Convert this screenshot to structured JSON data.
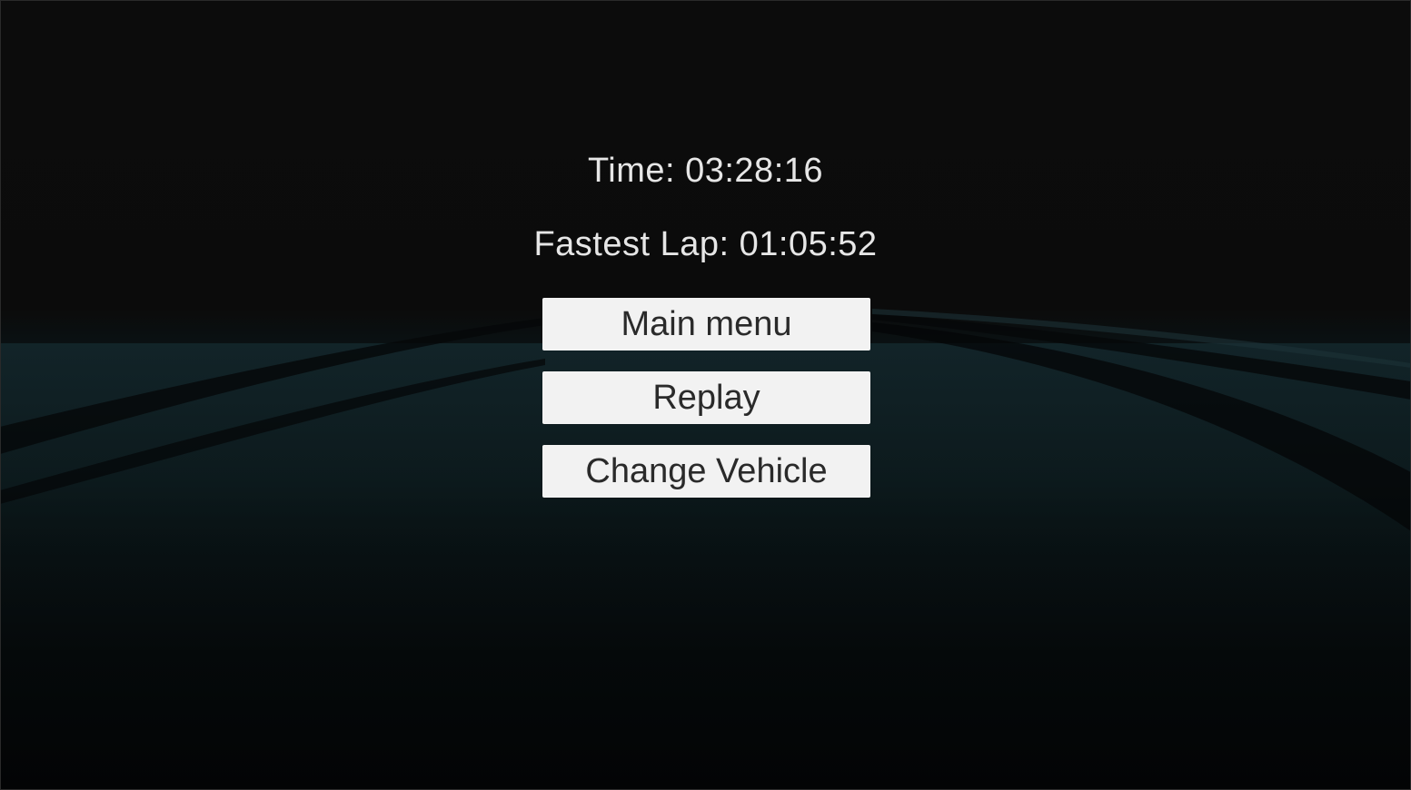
{
  "results": {
    "time_text": "Time: 03:28:16",
    "fastest_lap_text": "Fastest Lap: 01:05:52"
  },
  "menu": {
    "main_menu_label": "Main menu",
    "replay_label": "Replay",
    "change_vehicle_label": "Change Vehicle"
  },
  "colors": {
    "background": "#0b0b0b",
    "track_tint": "#0b1619",
    "button_bg": "#f2f2f2",
    "button_text": "#2a2a2a",
    "stat_text": "#e6e6e6"
  }
}
